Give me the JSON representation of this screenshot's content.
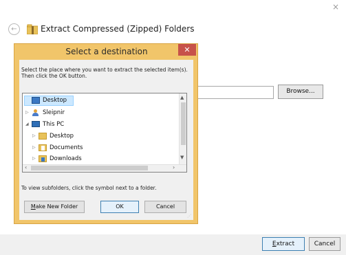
{
  "wizard": {
    "title": "Extract Compressed (Zipped) Folders",
    "browse_label": "Browse...",
    "extract_label": "xtract",
    "extract_mnemonic": "E",
    "cancel_label": "Cancel",
    "close_glyph": "×",
    "back_glyph": "←"
  },
  "dialog": {
    "title": "Select a destination",
    "close_glyph": "✕",
    "instructions": "Select the place where you want to extract the selected item(s).  Then click the OK button.",
    "tree": [
      {
        "label": "Desktop",
        "icon": "desktop-icon",
        "selected": true
      },
      {
        "label": "Sleipnir",
        "icon": "user-icon",
        "expander": "collapsed"
      },
      {
        "label": "This PC",
        "icon": "computer-icon",
        "expander": "expanded"
      },
      {
        "label": "Desktop",
        "icon": "folder-icon",
        "expander": "collapsed"
      },
      {
        "label": "Documents",
        "icon": "documents-folder-icon",
        "expander": "collapsed"
      },
      {
        "label": "Downloads",
        "icon": "downloads-folder-icon",
        "expander": "collapsed"
      }
    ],
    "hint": "To view subfolders, click the symbol next to a folder.",
    "new_folder_mnemonic": "M",
    "new_folder_label": "ake New Folder",
    "ok_label": "OK",
    "cancel_label": "Cancel"
  },
  "colors": {
    "dialog_frame": "#f1c56a",
    "close_button": "#c7524a",
    "selection": "#cce8ff"
  }
}
